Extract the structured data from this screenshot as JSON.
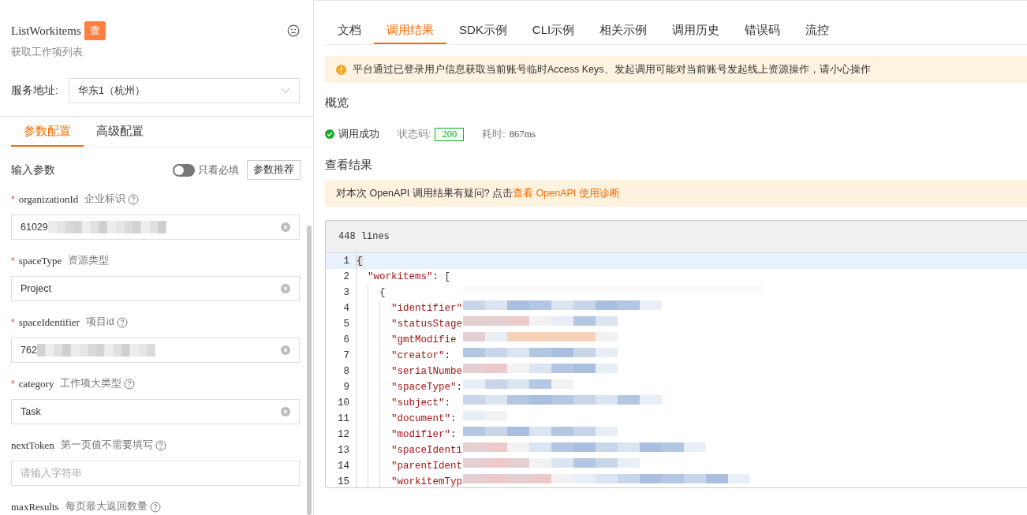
{
  "api": {
    "name": "ListWorkitems",
    "badge": "查",
    "description": "获取工作项列表"
  },
  "service": {
    "label": "服务地址:",
    "value": "华东1（杭州）"
  },
  "config_tabs": [
    {
      "label": "参数配置",
      "selected": true
    },
    {
      "label": "高级配置",
      "selected": false
    }
  ],
  "params_header": {
    "title": "输入参数",
    "required_only": {
      "label": "只看必填",
      "on": false
    },
    "recommend_button": "参数推荐"
  },
  "fields": [
    {
      "required_mark": "*",
      "name": "organizationId",
      "description": "企业标识",
      "help": true,
      "value": "61029",
      "redacted": true
    },
    {
      "required_mark": "*",
      "name": "spaceType",
      "description": "资源类型",
      "value": "Project"
    },
    {
      "required_mark": "*",
      "name": "spaceIdentifier",
      "description": "项目id",
      "help": true,
      "value": "762",
      "redacted": true
    },
    {
      "required_mark": "*",
      "name": "category",
      "description": "工作项大类型",
      "help": true,
      "value": "Task"
    },
    {
      "name": "nextToken",
      "description": "第一页值不需要填写",
      "help": true,
      "placeholder": "请输入字符串"
    },
    {
      "name": "maxResults",
      "description": "每页最大返回数量",
      "help": true
    }
  ],
  "result_tabs": [
    {
      "label": "文档",
      "selected": false
    },
    {
      "label": "调用结果",
      "selected": true
    },
    {
      "label": "SDK示例",
      "selected": false
    },
    {
      "label": "CLI示例",
      "selected": false
    },
    {
      "label": "相关示例",
      "selected": false
    },
    {
      "label": "调用历史",
      "selected": false
    },
    {
      "label": "错误码",
      "selected": false
    },
    {
      "label": "流控",
      "selected": false
    }
  ],
  "warning": "平台通过已登录用户信息获取当前账号临时Access Keys、发起调用可能对当前账号发起线上资源操作，请小心操作",
  "overview": {
    "title": "概览",
    "status": "调用成功",
    "success": true,
    "code_label": "状态码:",
    "code": "200",
    "time_label": "耗时:",
    "time": "867ms"
  },
  "results": {
    "title": "查看结果",
    "hint": "对本次 OpenAPI 调用结果有疑问? 点击",
    "hint_link": "查看 OpenAPI 使用诊断",
    "line_count": "448 lines"
  },
  "code": [
    {
      "number": "1",
      "punct": "{",
      "selected": true,
      "children": [
        {
          "number": "2",
          "key": "\"workitems\"",
          "punct": ": [",
          "selected": false,
          "children": [
            {
              "number": "3",
              "punct": "{",
              "selected": false,
              "children": [
                {
                  "number": "4",
                  "key": "\"identifier\"",
                  "selected": false
                },
                {
                  "number": "5",
                  "key": "\"statusStage",
                  "selected": false
                },
                {
                  "number": "6",
                  "key": "\"gmtModifie",
                  "selected": false
                },
                {
                  "number": "7",
                  "key": "\"creator\"",
                  "punct": ":",
                  "selected": false
                },
                {
                  "number": "8",
                  "key": "\"serialNumbe",
                  "selected": false
                },
                {
                  "number": "9",
                  "key": "\"spaceType\"",
                  "punct": ":",
                  "selected": false
                },
                {
                  "number": "10",
                  "key": "\"subject\"",
                  "punct": ":",
                  "selected": false
                },
                {
                  "number": "11",
                  "key": "\"document\"",
                  "punct": ":",
                  "selected": false
                },
                {
                  "number": "12",
                  "key": "\"modifier\"",
                  "punct": ":",
                  "selected": false
                },
                {
                  "number": "13",
                  "key": "\"spaceIdenti",
                  "selected": false
                },
                {
                  "number": "14",
                  "key": "\"parentIdent",
                  "selected": false
                },
                {
                  "number": "15",
                  "key": "\"workitemTyp",
                  "selected": false
                }
              ]
            }
          ]
        }
      ]
    }
  ]
}
